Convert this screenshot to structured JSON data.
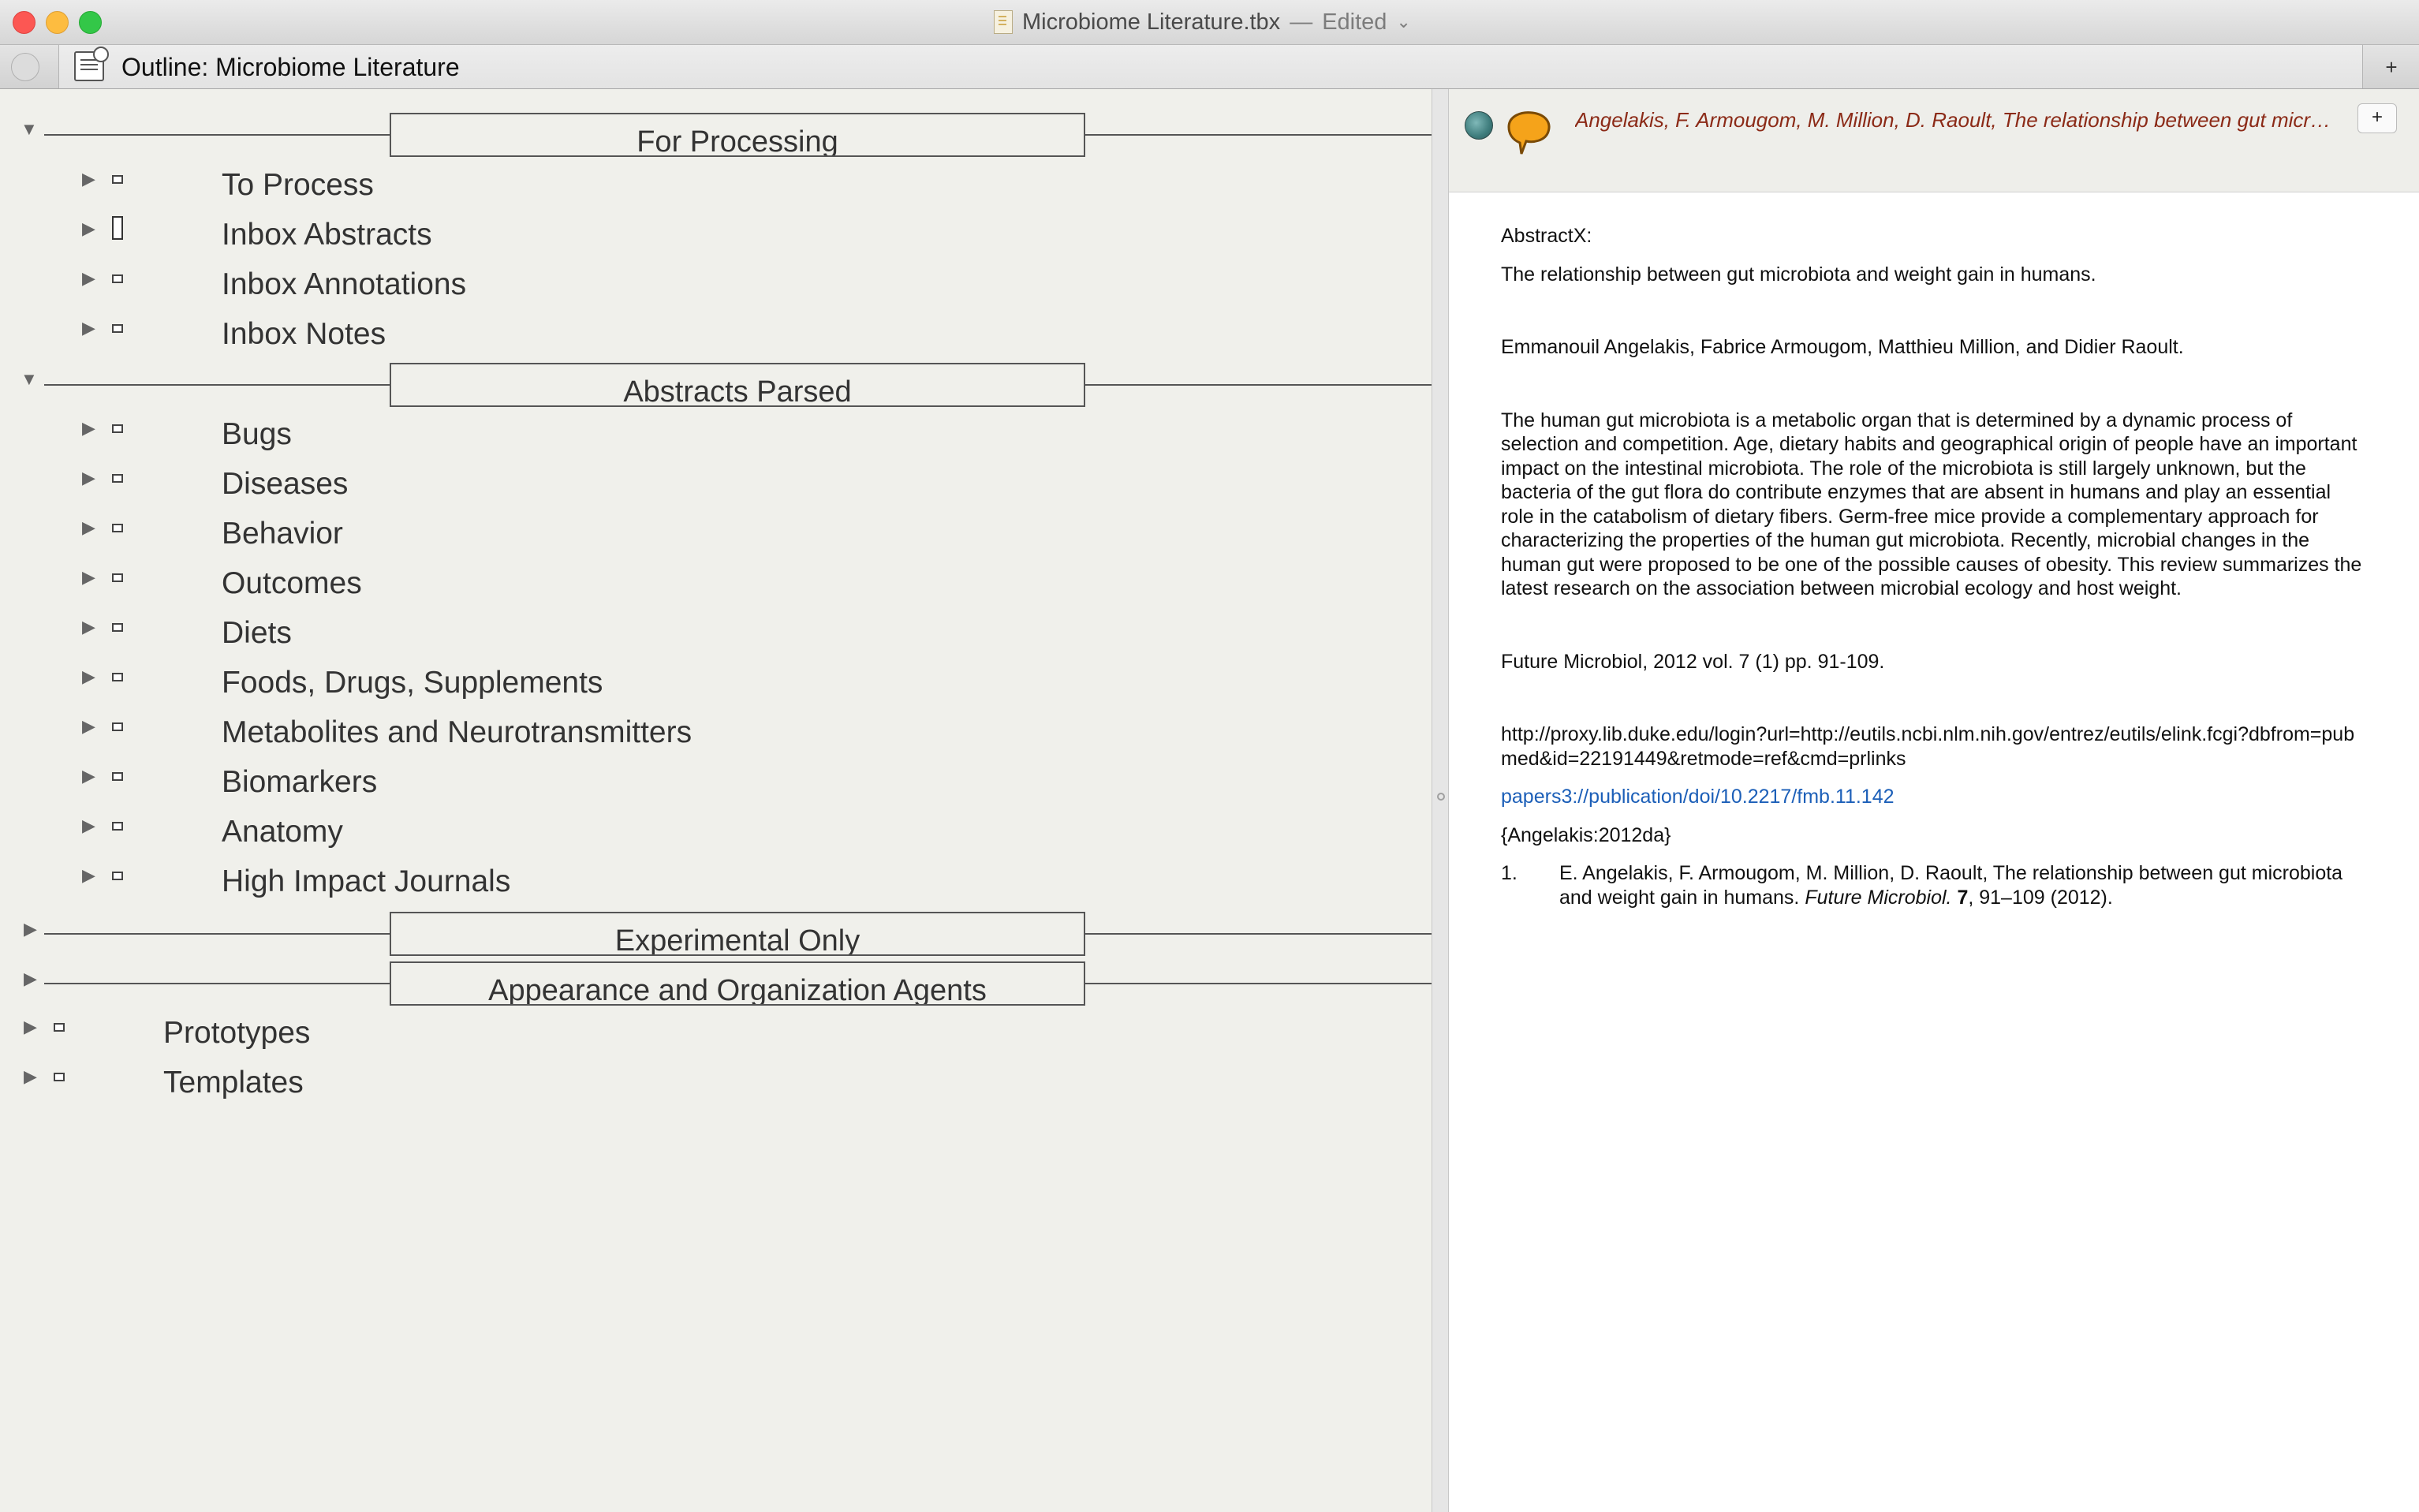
{
  "window": {
    "title": "Microbiome Literature.tbx",
    "separator": "—",
    "edited": "Edited",
    "chevron": "⌄"
  },
  "tab": {
    "label": "Outline: Microbiome Literature",
    "add_label": "+"
  },
  "outline": {
    "sections": [
      {
        "label": "For Processing",
        "expanded": true
      },
      {
        "label": "Abstracts Parsed",
        "expanded": true
      },
      {
        "label": "Experimental Only",
        "expanded": false
      },
      {
        "label": "Appearance and Organization Agents",
        "expanded": false
      }
    ],
    "for_processing_items": [
      "To Process",
      "Inbox Abstracts",
      "Inbox Annotations",
      "Inbox Notes"
    ],
    "abstracts_parsed_items": [
      "Bugs",
      "Diseases",
      "Behavior",
      "Outcomes",
      "Diets",
      "Foods, Drugs, Supplements",
      "Metabolites and Neurotransmitters",
      "Biomarkers",
      "Anatomy",
      "High Impact Journals"
    ],
    "root_items": [
      "Prototypes",
      "Templates"
    ]
  },
  "note": {
    "header_title": "Angelakis, F. Armougom, M. Million, D. Raoult, The relationship between gut micr…",
    "header_plus": "+",
    "heading": "AbstractX:",
    "title": "The relationship between gut microbiota and weight gain in humans.",
    "authors": "Emmanouil Angelakis, Fabrice Armougom, Matthieu Million, and Didier Raoult.",
    "abstract": "The human gut microbiota is a metabolic organ that is determined by a dynamic process of selection and competition. Age, dietary habits and geographical origin of people have an important impact on the intestinal microbiota. The role of the microbiota is still largely unknown, but the bacteria of the gut flora do contribute enzymes that are absent in humans and play an essential role in the catabolism of dietary fibers. Germ-free mice provide a complementary approach for characterizing the properties of the human gut microbiota. Recently, microbial changes in the human gut were proposed to be one of the possible causes of obesity. This review summarizes the latest research on the association between microbial ecology and host weight.",
    "citation": "Future Microbiol, 2012 vol. 7 (1) pp. 91-109.",
    "url": "http://proxy.lib.duke.edu/login?url=http://eutils.ncbi.nlm.nih.gov/entrez/eutils/elink.fcgi?dbfrom=pubmed&id=22191449&retmode=ref&cmd=prlinks",
    "papers_link": "papers3://publication/doi/10.2217/fmb.11.142",
    "cite_key": "{Angelakis:2012da}",
    "reference": {
      "number": "1.",
      "authors_title": "E. Angelakis, F. Armougom, M. Million, D. Raoult, The relationship between gut microbiota and weight gain in humans. ",
      "journal": "Future Microbiol.",
      "volume": "7",
      "pages_year": ", 91–109 (2012)."
    }
  },
  "colors": {
    "note_title": "#8b2a17",
    "link": "#1c5fb8",
    "outline_bg": "#f0f0eb"
  }
}
